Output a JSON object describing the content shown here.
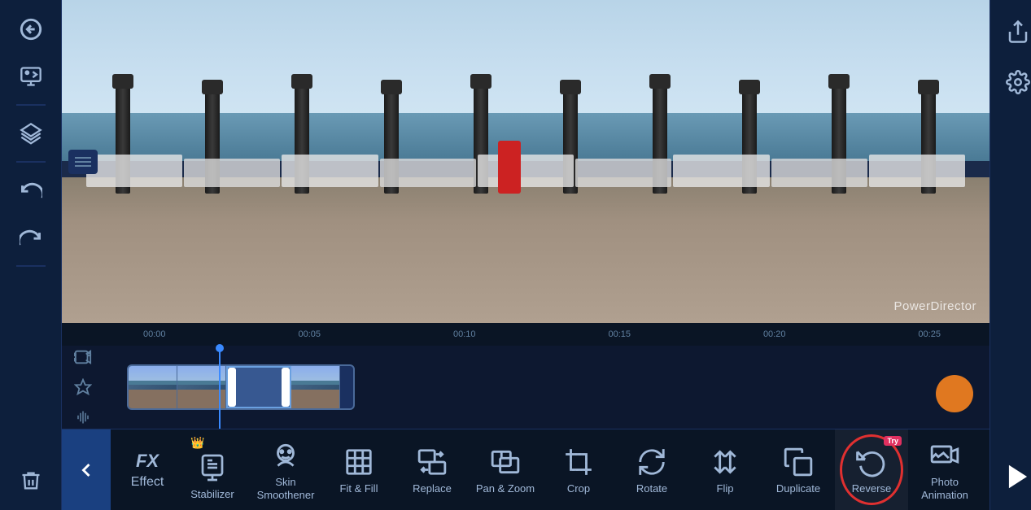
{
  "app": {
    "title": "PowerDirector"
  },
  "sidebar_left": {
    "back_label": "Back",
    "media_label": "Media",
    "layers_label": "Layers",
    "undo_label": "Undo",
    "redo_label": "Redo",
    "delete_label": "Delete",
    "menu_label": "Menu"
  },
  "sidebar_right": {
    "share_label": "Share",
    "settings_label": "Settings",
    "play_label": "Play"
  },
  "timeline": {
    "ruler_marks": [
      "00:00",
      "00:05",
      "00:10",
      "00:15",
      "00:20",
      "00:25"
    ]
  },
  "toolbar": {
    "back_icon": "←",
    "items": [
      {
        "id": "fx",
        "label": "Effect",
        "icon": "fx",
        "crown": false
      },
      {
        "id": "stabilizer",
        "label": "Stabilizer",
        "icon": "stabilizer",
        "crown": true
      },
      {
        "id": "skin-smoothener",
        "label": "Skin\nSmoothener",
        "icon": "face",
        "crown": false
      },
      {
        "id": "fit-fill",
        "label": "Fit & Fill",
        "icon": "fit-fill",
        "crown": false
      },
      {
        "id": "replace",
        "label": "Replace",
        "icon": "replace",
        "crown": false
      },
      {
        "id": "pan-zoom",
        "label": "Pan & Zoom",
        "icon": "pan-zoom",
        "crown": false
      },
      {
        "id": "crop",
        "label": "Crop",
        "icon": "crop",
        "crown": false
      },
      {
        "id": "rotate",
        "label": "Rotate",
        "icon": "rotate",
        "crown": false
      },
      {
        "id": "flip",
        "label": "Flip",
        "icon": "flip",
        "crown": false
      },
      {
        "id": "duplicate",
        "label": "Duplicate",
        "icon": "duplicate",
        "crown": false
      },
      {
        "id": "reverse",
        "label": "Reverse",
        "icon": "reverse",
        "crown": false,
        "highlighted": true,
        "try": true
      },
      {
        "id": "photo-animation",
        "label": "Photo\nAnimation",
        "icon": "photo-animation",
        "crown": false
      }
    ]
  },
  "watermark": "PowerDirector"
}
